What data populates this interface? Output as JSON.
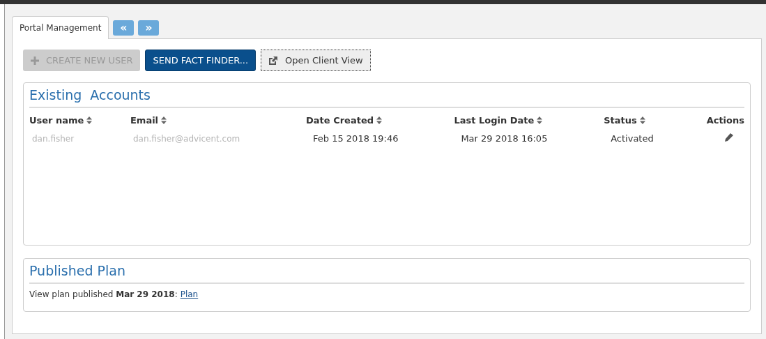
{
  "tabs": [
    {
      "label": "Portal Management",
      "selected": true
    }
  ],
  "tab_nav": [
    {
      "label": "«"
    },
    {
      "label": "»"
    }
  ],
  "toolbar": [
    {
      "label": "CREATE NEW USER",
      "kind": "add",
      "disabled": true
    },
    {
      "label": "SEND FACT FINDER...",
      "kind": "primary",
      "disabled": false
    },
    {
      "label": "Open Client View",
      "kind": "external",
      "disabled": false
    }
  ],
  "accounts": {
    "title": "Existing  Accounts",
    "columns": [
      {
        "label": "User name",
        "sortable": true
      },
      {
        "label": "Email",
        "sortable": true
      },
      {
        "label": "Date Created",
        "sortable": true
      },
      {
        "label": "Last Login Date",
        "sortable": true
      },
      {
        "label": "Status",
        "sortable": true
      },
      {
        "label": "Actions",
        "sortable": false
      }
    ],
    "rows": [
      {
        "user_name": "dan.fisher",
        "email": "dan.fisher@advicent.com",
        "date_created": "Feb 15 2018 19:46",
        "last_login": "Mar 29 2018 16:05",
        "status": "Activated"
      }
    ]
  },
  "published_plan": {
    "title": "Published Plan",
    "text": "View plan published **Mar 29 2018**:",
    "link": "Plan"
  }
}
